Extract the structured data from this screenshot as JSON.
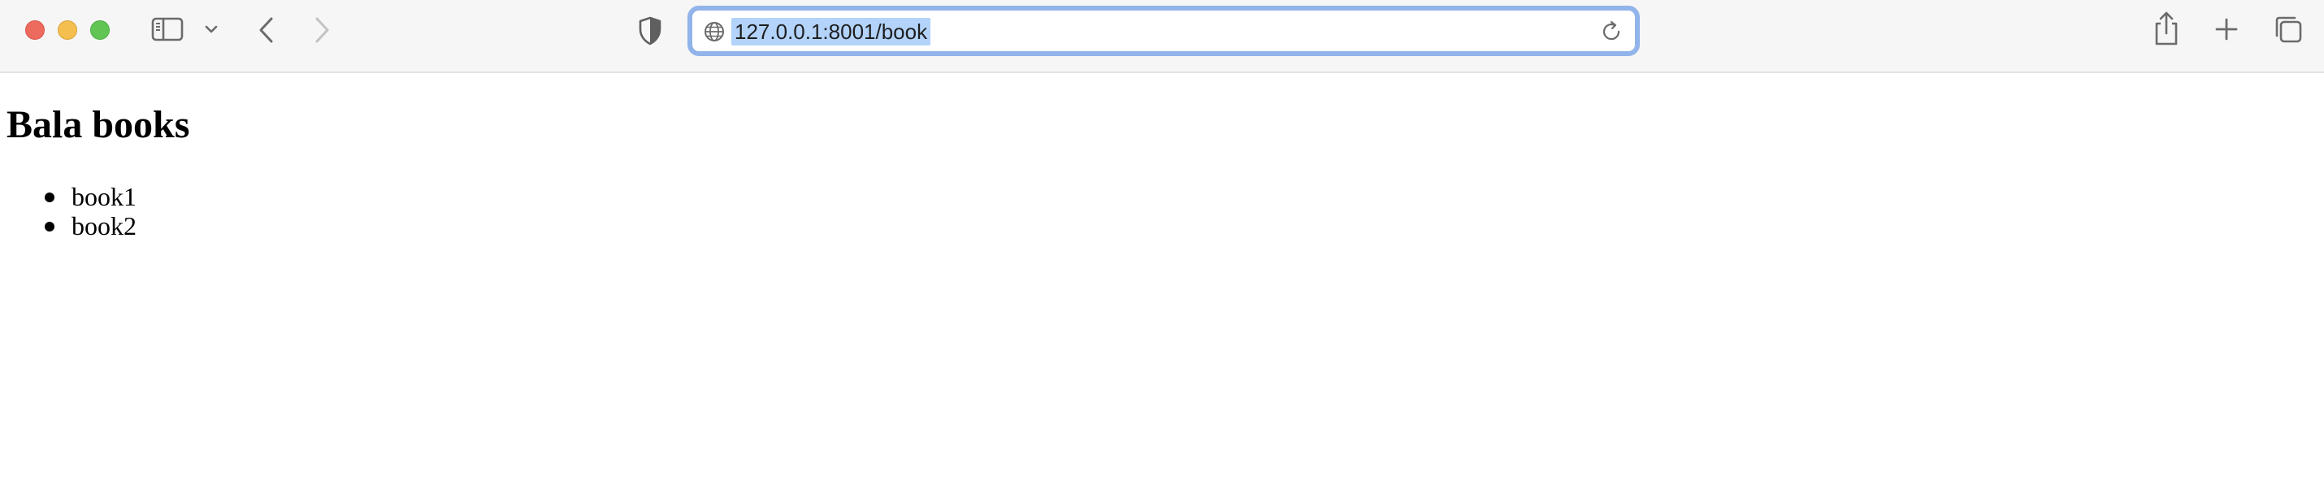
{
  "browser": {
    "url": "127.0.0.1:8001/book",
    "icons": {
      "close": "close-window",
      "minimize": "minimize-window",
      "maximize": "maximize-window",
      "sidebar": "sidebar-icon",
      "sidebar_menu": "chevron-down-icon",
      "back": "chevron-left-icon",
      "forward": "chevron-right-icon",
      "privacy": "shield-icon",
      "site": "globe-icon",
      "reload": "reload-icon",
      "share": "share-icon",
      "new_tab": "plus-icon",
      "tab_overview": "tabs-icon"
    },
    "colors": {
      "toolbar_bg": "#f6f6f6",
      "address_focus_ring": "#91b4ea",
      "url_selection": "#b3d3fb",
      "close": "#ec6a5e",
      "minimize": "#f4bf4f",
      "maximize": "#61c554"
    }
  },
  "page": {
    "heading": "Bala books",
    "books": [
      "book1",
      "book2"
    ]
  }
}
